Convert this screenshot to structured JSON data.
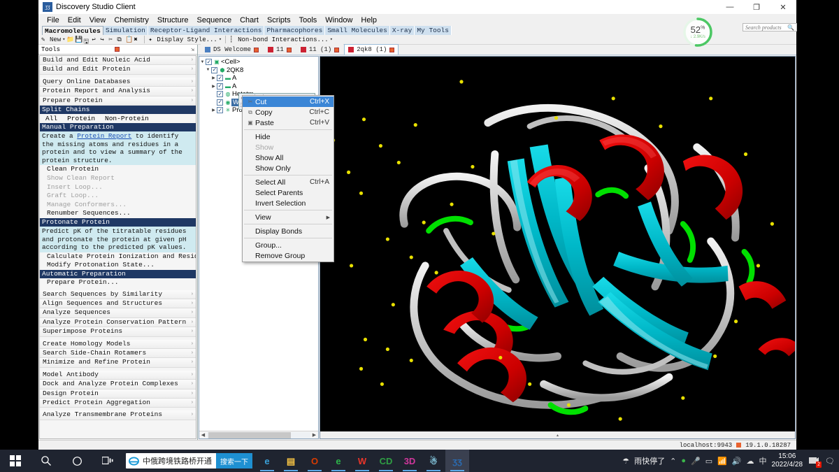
{
  "window": {
    "title": "Discovery Studio Client",
    "icon": "ds-logo-icon",
    "controls": {
      "minimize": "—",
      "maximize": "❐",
      "close": "✕"
    }
  },
  "menubar": [
    "File",
    "Edit",
    "View",
    "Chemistry",
    "Structure",
    "Sequence",
    "Chart",
    "Scripts",
    "Tools",
    "Window",
    "Help"
  ],
  "ribbon_tabs": [
    {
      "label": "Macromolecules",
      "active": true
    },
    {
      "label": "Simulation",
      "active": false
    },
    {
      "label": "Receptor-Ligand Interactions",
      "active": false
    },
    {
      "label": "Pharmacophores",
      "active": false
    },
    {
      "label": "Small Molecules",
      "active": false
    },
    {
      "label": "X-ray",
      "active": false
    },
    {
      "label": "My Tools",
      "active": false
    }
  ],
  "toolbar": {
    "new_label": "New",
    "display_style_label": "Display Style...",
    "nonbond_label": "Non-bond Interactions..."
  },
  "tools_panel": {
    "header": "Tools",
    "items": [
      {
        "type": "row",
        "label": "Build and Edit Nucleic Acid"
      },
      {
        "type": "row",
        "label": "Build and Edit Protein"
      },
      {
        "type": "gap"
      },
      {
        "type": "row",
        "label": "Query Online Databases"
      },
      {
        "type": "row",
        "label": "Protein Report and Analysis"
      },
      {
        "type": "row",
        "label": "Prepare Protein"
      },
      {
        "type": "header",
        "label": "Split Chains"
      },
      {
        "type": "inline",
        "options": [
          "All",
          "Protein",
          "Non-Protein"
        ]
      },
      {
        "type": "header",
        "label": "Manual Preparation"
      },
      {
        "type": "help",
        "pre": "Create a ",
        "link": "Protein Report",
        "post": " to identify the missing atoms and residues in a protein and to view a summary of the protein structure."
      },
      {
        "type": "sub",
        "label": "Clean Protein",
        "disabled": false
      },
      {
        "type": "sub",
        "label": "Show Clean Report",
        "disabled": true
      },
      {
        "type": "sub",
        "label": "Insert Loop...",
        "disabled": true
      },
      {
        "type": "sub",
        "label": "Graft Loop...",
        "disabled": true
      },
      {
        "type": "sub",
        "label": "Manage Conformers...",
        "disabled": true
      },
      {
        "type": "sub",
        "label": "Renumber Sequences...",
        "disabled": false
      },
      {
        "type": "header",
        "label": "Protonate Protein"
      },
      {
        "type": "help",
        "pre": "Predict pK of the titratable residues and protonate the protein at given pH according to the predicted pK values.",
        "link": "",
        "post": ""
      },
      {
        "type": "sub",
        "label": "Calculate Protein Ionization and Residue pK...",
        "disabled": false
      },
      {
        "type": "sub",
        "label": "Modify Protonation State...",
        "disabled": false
      },
      {
        "type": "header",
        "label": "Automatic Preparation"
      },
      {
        "type": "sub",
        "label": "Prepare Protein...",
        "disabled": false
      },
      {
        "type": "gap"
      },
      {
        "type": "row",
        "label": "Search Sequences by Similarity"
      },
      {
        "type": "row",
        "label": "Align Sequences and Structures"
      },
      {
        "type": "row",
        "label": "Analyze Sequences"
      },
      {
        "type": "row",
        "label": "Analyze Protein Conservation Pattern"
      },
      {
        "type": "row",
        "label": "Superimpose Proteins"
      },
      {
        "type": "gap"
      },
      {
        "type": "row",
        "label": "Create Homology Models"
      },
      {
        "type": "row",
        "label": "Search Side-Chain Rotamers"
      },
      {
        "type": "row",
        "label": "Minimize and Refine Protein"
      },
      {
        "type": "gap"
      },
      {
        "type": "row",
        "label": "Model Antibody"
      },
      {
        "type": "row",
        "label": "Dock and Analyze Protein Complexes"
      },
      {
        "type": "row",
        "label": "Design Protein"
      },
      {
        "type": "row",
        "label": "Predict Protein Aggregation"
      },
      {
        "type": "gap"
      },
      {
        "type": "row",
        "label": "Analyze Transmembrane Proteins"
      }
    ]
  },
  "document_tabs": [
    {
      "label": "DS Welcome",
      "active": false
    },
    {
      "label": "11",
      "active": false
    },
    {
      "label": "11 (1)",
      "active": false
    },
    {
      "label": "2qk8 (1)",
      "active": true
    }
  ],
  "tree": [
    {
      "label": "<Cell>",
      "indent": 0,
      "expanded": true,
      "checked": true,
      "selected": false,
      "icon": "cell-icon"
    },
    {
      "label": "2QK8",
      "indent": 1,
      "expanded": true,
      "checked": true,
      "selected": false,
      "icon": "molecule-icon"
    },
    {
      "label": "A",
      "indent": 2,
      "expanded": false,
      "checked": true,
      "selected": false,
      "icon": "chain-icon"
    },
    {
      "label": "A",
      "indent": 2,
      "expanded": false,
      "checked": true,
      "selected": false,
      "icon": "chain-icon"
    },
    {
      "label": "Hetatm",
      "indent": 2,
      "expanded": null,
      "checked": true,
      "selected": false,
      "icon": "hetatm-icon"
    },
    {
      "label": "Water",
      "indent": 2,
      "expanded": null,
      "checked": true,
      "selected": true,
      "icon": "water-icon"
    },
    {
      "label": "Protein",
      "indent": 2,
      "expanded": false,
      "checked": true,
      "selected": false,
      "icon": "protein-icon"
    }
  ],
  "context_menu": [
    {
      "label": "Cut",
      "shortcut": "Ctrl+X",
      "icon": "cut-icon",
      "selected": true,
      "disabled": false
    },
    {
      "label": "Copy",
      "shortcut": "Ctrl+C",
      "icon": "copy-icon",
      "selected": false,
      "disabled": false
    },
    {
      "label": "Paste",
      "shortcut": "Ctrl+V",
      "icon": "paste-icon",
      "selected": false,
      "disabled": false
    },
    {
      "sep": true
    },
    {
      "label": "Hide",
      "shortcut": "",
      "icon": "",
      "selected": false,
      "disabled": false
    },
    {
      "label": "Show",
      "shortcut": "",
      "icon": "",
      "selected": false,
      "disabled": true
    },
    {
      "label": "Show All",
      "shortcut": "",
      "icon": "",
      "selected": false,
      "disabled": false
    },
    {
      "label": "Show Only",
      "shortcut": "",
      "icon": "",
      "selected": false,
      "disabled": false
    },
    {
      "sep": true
    },
    {
      "label": "Select All",
      "shortcut": "Ctrl+A",
      "icon": "",
      "selected": false,
      "disabled": false
    },
    {
      "label": "Select Parents",
      "shortcut": "",
      "icon": "",
      "selected": false,
      "disabled": false
    },
    {
      "label": "Invert Selection",
      "shortcut": "",
      "icon": "",
      "selected": false,
      "disabled": false
    },
    {
      "sep": true
    },
    {
      "label": "View",
      "shortcut": "",
      "icon": "",
      "submenu": true,
      "selected": false,
      "disabled": false
    },
    {
      "sep": true
    },
    {
      "label": "Display Bonds",
      "shortcut": "",
      "icon": "",
      "selected": false,
      "disabled": false
    },
    {
      "sep": true
    },
    {
      "label": "Group...",
      "shortcut": "",
      "icon": "",
      "selected": false,
      "disabled": false
    },
    {
      "label": "Remove Group",
      "shortcut": "",
      "icon": "",
      "selected": false,
      "disabled": false
    }
  ],
  "progress_widget": {
    "percent": "52",
    "percent_symbol": "%",
    "rate": "↓ 2.9K/s",
    "value": 52,
    "color": "#4cc764"
  },
  "search": {
    "placeholder": "Search products",
    "value": "",
    "icon": "search-icon"
  },
  "statusbar": {
    "server": "localhost:9943",
    "version": "19.1.0.18287"
  },
  "viewport": {
    "colors": {
      "background": "#000000",
      "sheet": "#00c6d4",
      "helix": "#cc0000",
      "loop": "#c8c8c8",
      "turn": "#00e000",
      "water": "#e8e000"
    }
  },
  "taskbar": {
    "start_icon": "windows-start-icon",
    "search_icon": "search-icon",
    "cortana_icon": "cortana-circle-icon",
    "taskview_icon": "task-view-icon",
    "ie_widget": {
      "icon": "ie-icon",
      "text": "中俄跨境铁路桥开通",
      "button": "搜索一下"
    },
    "apps": [
      {
        "name": "edge",
        "glyph": "e",
        "color": "#3aa0d8",
        "active": false
      },
      {
        "name": "file-explorer",
        "glyph": "▤",
        "color": "#f5c244",
        "active": false
      },
      {
        "name": "office",
        "glyph": "O",
        "color": "#d83b01",
        "active": false
      },
      {
        "name": "ie-classic",
        "glyph": "e",
        "color": "#2db44a",
        "active": false
      },
      {
        "name": "wps",
        "glyph": "W",
        "color": "#e8352a",
        "active": false
      },
      {
        "name": "cd-app",
        "glyph": "CD",
        "color": "#2f9e44",
        "active": false
      },
      {
        "name": "3d-app",
        "glyph": "3D",
        "color": "#d0379c",
        "active": false
      },
      {
        "name": "character-app",
        "glyph": "☃",
        "color": "#8fd8f0",
        "active": false
      },
      {
        "name": "discovery-studio",
        "glyph": "ʒʒ",
        "color": "#2a6ab0",
        "active": true
      }
    ],
    "tray": {
      "weather_icon": "umbrella-icon",
      "weather_text": "雨快停了",
      "chevron": "⌃",
      "icons": [
        "shield-green-icon",
        "microphone-icon",
        "battery-icon",
        "wifi-icon",
        "volume-icon",
        "cloud-icon"
      ],
      "ime": "中",
      "time": "15:06",
      "date": "2022/4/28",
      "notification_icon": "notification-icon",
      "notification_count": "2",
      "action_center_icon": "action-center-icon"
    }
  }
}
